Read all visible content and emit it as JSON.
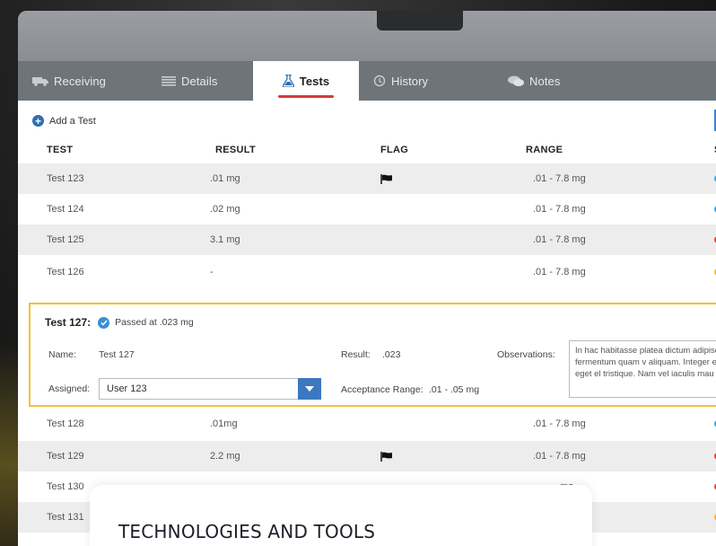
{
  "tabs": [
    {
      "label": "Receiving",
      "icon": "truck-icon"
    },
    {
      "label": "Details",
      "icon": "list-icon"
    },
    {
      "label": "Tests",
      "icon": "flask-icon",
      "active": true
    },
    {
      "label": "History",
      "icon": "history-icon"
    },
    {
      "label": "Notes",
      "icon": "chat-bubbles-icon"
    }
  ],
  "add_test_label": "Add a Test",
  "columns": {
    "test": "TEST",
    "result": "RESULT",
    "flag": "FLAG",
    "range": "RANGE",
    "status": "S"
  },
  "rows_top": [
    {
      "test": "Test 123",
      "result": ".01 mg",
      "flag": true,
      "range": ".01 - 7.8 mg",
      "status_color": "#3aa8e0"
    },
    {
      "test": "Test 124",
      "result": ".02 mg",
      "flag": false,
      "range": ".01 - 7.8 mg",
      "status_color": "#3aa8e0"
    },
    {
      "test": "Test 125",
      "result": "3.1 mg",
      "flag": false,
      "range": ".01 - 7.8 mg",
      "status_color": "#e04848"
    },
    {
      "test": "Test 126",
      "result": "-",
      "flag": false,
      "range": ".01 - 7.8 mg",
      "status_color": "#f2b134"
    }
  ],
  "expanded": {
    "title": "Test 127:",
    "status_text": "Passed at .023 mg",
    "name_label": "Name:",
    "name_value": "Test 127",
    "assigned_label": "Assigned:",
    "assigned_value": "User 123",
    "result_label": "Result:",
    "result_value": ".023",
    "acceptance_label": "Acceptance Range:",
    "acceptance_value": ".01 - .05 mg",
    "observations_label": "Observations:",
    "observations_text": "In hac habitasse platea dictum adipiscing fermentum quam v aliquam. Integer et elit eget el tristique. Nam vel iaculis mau"
  },
  "rows_bottom": [
    {
      "test": "Test 128",
      "result": ".01mg",
      "flag": false,
      "range": ".01 - 7.8 mg",
      "status_color": "#3aa8e0"
    },
    {
      "test": "Test 129",
      "result": "2.2 mg",
      "flag": true,
      "range": ".01 - 7.8 mg",
      "status_color": "#e04848"
    },
    {
      "test": "Test 130",
      "result": "",
      "flag": false,
      "range": "mg",
      "status_color": "#e04848"
    },
    {
      "test": "Test 131",
      "result": "",
      "flag": false,
      "range": "",
      "status_color": "#f2b134"
    }
  ],
  "overlay_title": "TECHNOLOGIES AND TOOLS",
  "colors": {
    "accent_blue": "#3c78c0",
    "tab_underline": "#d23b3b",
    "expanded_border": "#f1c232"
  }
}
